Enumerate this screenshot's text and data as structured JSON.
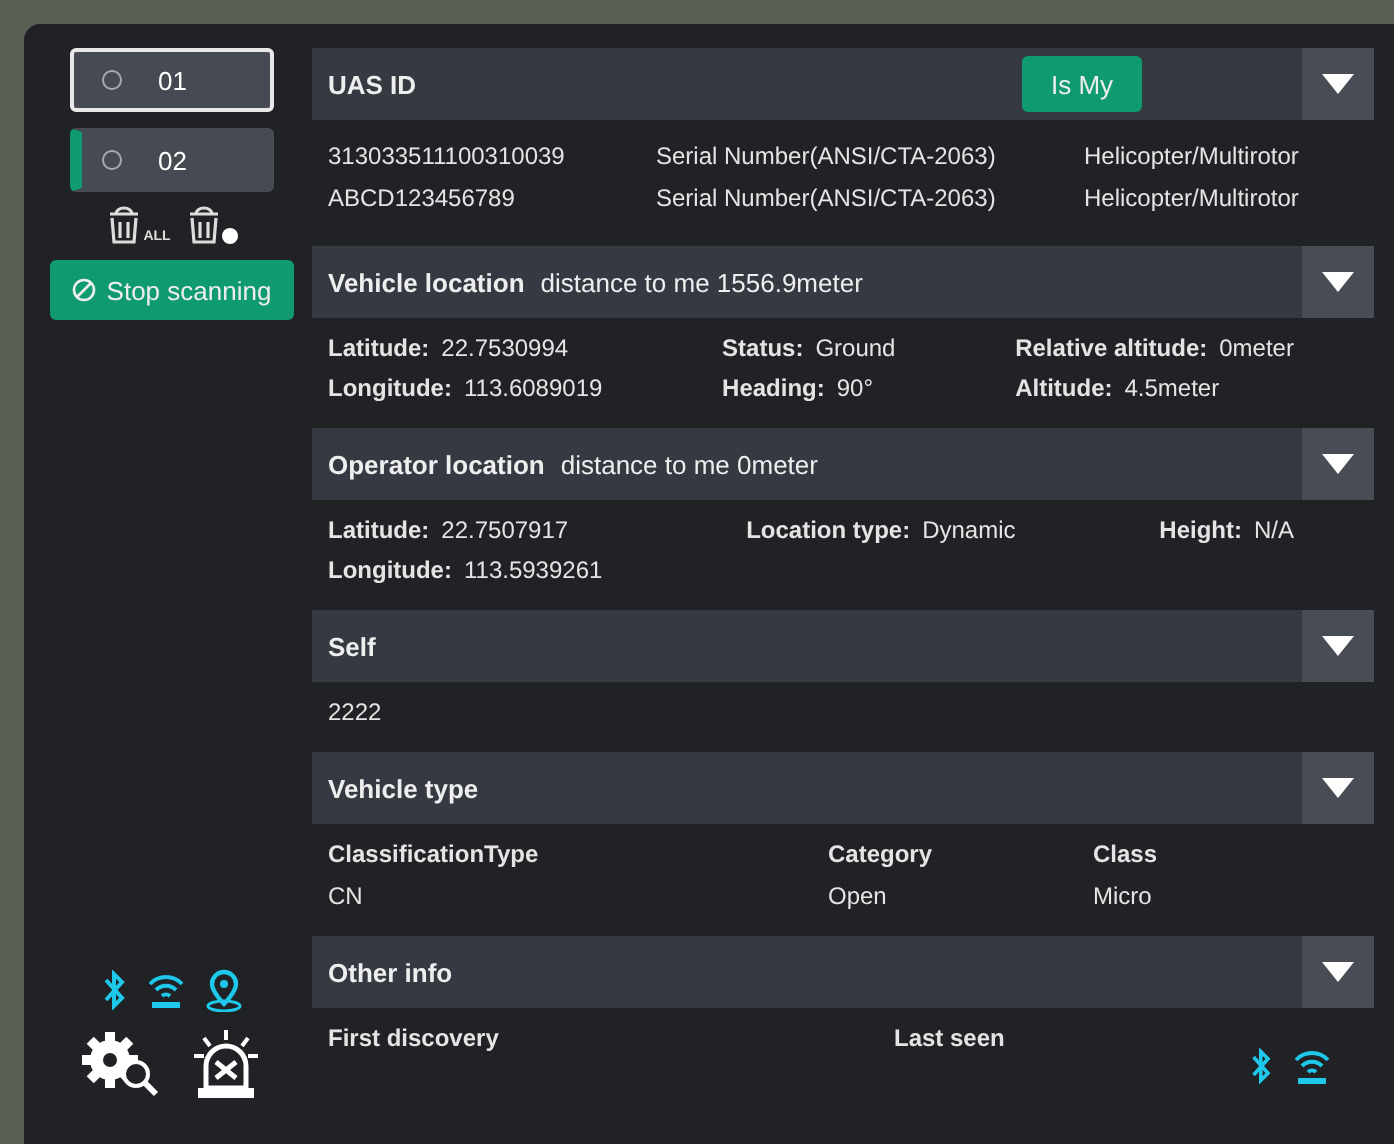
{
  "devices": [
    {
      "label": "01",
      "selected": true,
      "active": false
    },
    {
      "label": "02",
      "selected": false,
      "active": true
    }
  ],
  "trash_all_label": "ALL",
  "scan_button": {
    "label": "Stop scanning",
    "scanning": true
  },
  "sections": [
    {
      "kind": "table",
      "title": "UAS ID",
      "button": "Is My",
      "rows": [
        [
          "313033511100310039",
          "Serial Number(ANSI/CTA-2063)",
          "Helicopter/Multirotor"
        ],
        [
          "ABCD123456789",
          "Serial Number(ANSI/CTA-2063)",
          "Helicopter/Multirotor"
        ]
      ]
    },
    {
      "kind": "fields",
      "title": "Vehicle location",
      "subtitle": "distance to me 1556.9meter",
      "fields": [
        {
          "label": "Latitude:",
          "value": "22.7530994"
        },
        {
          "label": "Status:",
          "value": "Ground"
        },
        {
          "label": "Relative altitude:",
          "value": "0meter"
        },
        {
          "label": "Longitude:",
          "value": "113.6089019"
        },
        {
          "label": "Heading:",
          "value": "90°"
        },
        {
          "label": "Altitude:",
          "value": "4.5meter"
        }
      ]
    },
    {
      "kind": "fields",
      "title": "Operator location",
      "subtitle": "distance to me 0meter",
      "fields": [
        {
          "label": "Latitude:",
          "value": "22.7507917"
        },
        {
          "label": "Location type:",
          "value": "Dynamic"
        },
        {
          "label": "Height:",
          "value": "N/A"
        },
        {
          "label": "Longitude:",
          "value": "113.5939261"
        }
      ]
    },
    {
      "kind": "text",
      "title": "Self",
      "text": "2222"
    },
    {
      "kind": "columns",
      "title": "Vehicle type",
      "columns": [
        {
          "header": "ClassificationType",
          "value": "CN"
        },
        {
          "header": "Category",
          "value": "Open"
        },
        {
          "header": "Class",
          "value": "Micro"
        }
      ]
    },
    {
      "kind": "columns",
      "title": "Other info",
      "columns": [
        {
          "header": "First discovery"
        },
        {
          "header": "Last seen"
        }
      ]
    }
  ]
}
